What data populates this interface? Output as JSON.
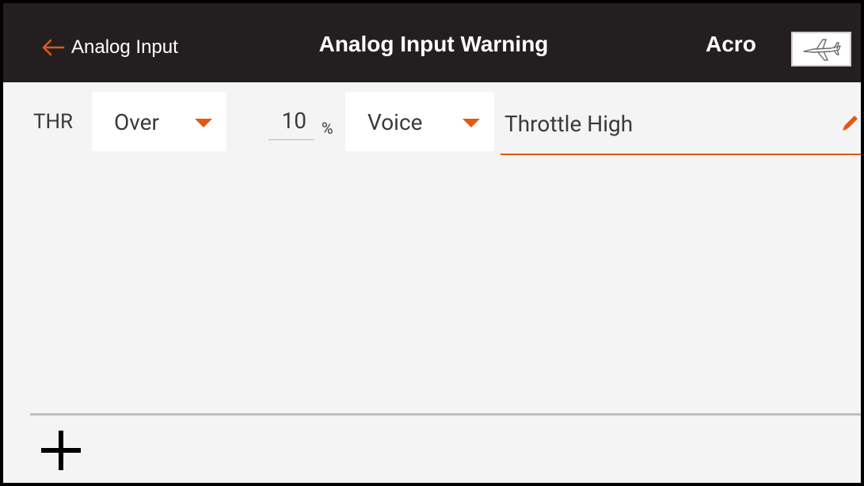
{
  "header": {
    "back_label": "Analog Input",
    "title": "Analog Input Warning",
    "model_name": "Acro",
    "model_icon": "airplane-icon"
  },
  "warning_row": {
    "channel": "THR",
    "condition": "Over",
    "threshold_value": "10",
    "threshold_unit": "%",
    "alert_type": "Voice",
    "alert_text": "Throttle High"
  },
  "colors": {
    "accent": "#e05a12",
    "header_bg": "#231f20",
    "screen_bg": "#f4f4f4"
  },
  "icons": {
    "back": "arrow-left-icon",
    "edit": "pencil-icon",
    "add": "plus-icon",
    "dropdown": "caret-down-icon"
  }
}
